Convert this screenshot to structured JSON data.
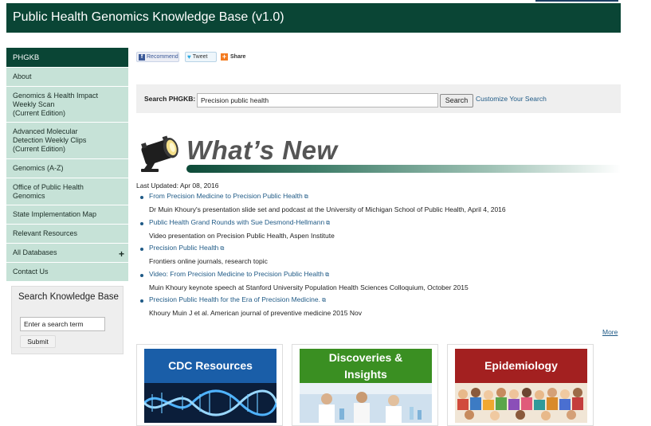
{
  "header": {
    "title": "Public Health Genomics Knowledge Base (v1.0)"
  },
  "sidebar": {
    "heading": "PHGKB",
    "items": [
      {
        "label": "About"
      },
      {
        "label": "Genomics & Health Impact\nWeekly Scan\n(Current Edition)"
      },
      {
        "label": "Advanced Molecular\nDetection Weekly Clips\n(Current Edition)"
      },
      {
        "label": "Genomics (A-Z)"
      },
      {
        "label": "Office of Public Health\nGenomics"
      },
      {
        "label": "State Implementation Map"
      },
      {
        "label": "Relevant Resources"
      },
      {
        "label": "All Databases",
        "expand": "+"
      },
      {
        "label": "Contact Us"
      }
    ],
    "search": {
      "title": "Search Knowledge Base",
      "placeholder": "Enter a search term",
      "button": "Submit"
    }
  },
  "social": {
    "recommend": "Recommend",
    "tweet": "Tweet",
    "share": "Share"
  },
  "search": {
    "label": "Search PHGKB:",
    "value": "Precision public health",
    "button": "Search",
    "customize": "Customize Your Search"
  },
  "whats_new": {
    "title": "What’s New",
    "updated": "Last Updated: Apr 08, 2016",
    "items": [
      {
        "title": "From Precision Medicine to Precision Public Health",
        "desc": "Dr Muin Khoury's presentation slide set and podcast at the University of Michigan School of Public Health, April 4, 2016"
      },
      {
        "title": "Public Health Grand Rounds with Sue Desmond-Hellmann",
        "desc": "Video presentation on Precision Public Health, Aspen Institute"
      },
      {
        "title": "Precision Public Health",
        "desc": "Frontiers online journals, research topic"
      },
      {
        "title": "Video: From Precision Medicine to Precision Public Health",
        "desc": "Muin Khoury keynote speech at Stanford University Population Health Sciences Colloquium, October 2015"
      },
      {
        "title": "Precision Public Health for the Era of Precision Medicine.",
        "desc": "Khoury Muin J et al. American journal of preventive medicine 2015 Nov"
      }
    ],
    "more": "More"
  },
  "cards": [
    {
      "title": "CDC Resources",
      "color": "#1a5ea8"
    },
    {
      "title": "Discoveries &\nInsights",
      "color": "#3a8f22"
    },
    {
      "title": "Epidemiology",
      "color": "#a32020"
    }
  ]
}
